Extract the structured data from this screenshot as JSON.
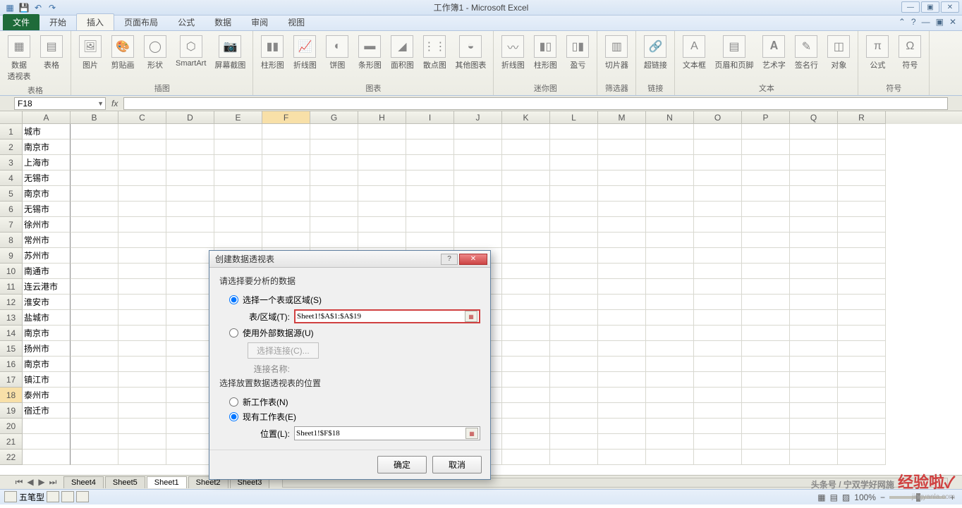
{
  "title": "工作簿1 - Microsoft Excel",
  "qat": {
    "save": "💾",
    "undo": "↶",
    "redo": "↷"
  },
  "wincontrols": {
    "min": "—",
    "max": "▣",
    "close": "✕"
  },
  "tabs": {
    "file": "文件",
    "home": "开始",
    "insert": "插入",
    "pagelayout": "页面布局",
    "formulas": "公式",
    "data": "数据",
    "review": "审阅",
    "view": "视图"
  },
  "ribbon": {
    "tables": {
      "label": "表格",
      "pivot": "数据\n透视表",
      "table": "表格"
    },
    "illus": {
      "label": "插图",
      "pic": "图片",
      "clip": "剪贴画",
      "shape": "形状",
      "smart": "SmartArt",
      "screenshot": "屏幕截图"
    },
    "charts": {
      "label": "图表",
      "column": "柱形图",
      "line": "折线图",
      "pie": "饼图",
      "bar": "条形图",
      "area": "面积图",
      "scatter": "散点图",
      "other": "其他图表"
    },
    "spark": {
      "label": "迷你图",
      "sline": "折线图",
      "scol": "柱形图",
      "swl": "盈亏"
    },
    "filter": {
      "label": "筛选器",
      "slicer": "切片器"
    },
    "links": {
      "label": "链接",
      "hyper": "超链接"
    },
    "text": {
      "label": "文本",
      "tbox": "文本框",
      "hf": "页眉和页脚",
      "wordart": "艺术字",
      "sig": "签名行",
      "obj": "对象"
    },
    "symbols": {
      "label": "符号",
      "eq": "公式",
      "sym": "符号"
    }
  },
  "namebox": "F18",
  "fx": "fx",
  "columns": [
    "A",
    "B",
    "C",
    "D",
    "E",
    "F",
    "G",
    "H",
    "I",
    "J",
    "K",
    "L",
    "M",
    "N",
    "O",
    "P",
    "Q",
    "R"
  ],
  "rows": [
    "1",
    "2",
    "3",
    "4",
    "5",
    "6",
    "7",
    "8",
    "9",
    "10",
    "11",
    "12",
    "13",
    "14",
    "15",
    "16",
    "17",
    "18",
    "19",
    "20",
    "21",
    "22"
  ],
  "data_a": [
    "城市",
    "南京市",
    "上海市",
    "无锡市",
    "南京市",
    "无锡市",
    "徐州市",
    "常州市",
    "苏州市",
    "南通市",
    "连云港市",
    "淮安市",
    "盐城市",
    "南京市",
    "扬州市",
    "南京市",
    "镇江市",
    "泰州市",
    "宿迁市",
    "",
    "",
    ""
  ],
  "sheets": {
    "s4": "Sheet4",
    "s5": "Sheet5",
    "s1": "Sheet1",
    "s2": "Sheet2",
    "s3": "Sheet3"
  },
  "dialog": {
    "title": "创建数据透视表",
    "section1": "请选择要分析的数据",
    "opt_range": "选择一个表或区域(S)",
    "lbl_range": "表/区域(T):",
    "val_range": "Sheet1!$A$1:$A$19",
    "opt_ext": "使用外部数据源(U)",
    "btn_conn": "选择连接(C)...",
    "lbl_conn": "连接名称:",
    "section2": "选择放置数据透视表的位置",
    "opt_new": "新工作表(N)",
    "opt_exist": "现有工作表(E)",
    "lbl_loc": "位置(L):",
    "val_loc": "Sheet1!$F$18",
    "ok": "确定",
    "cancel": "取消",
    "help": "?",
    "close": "✕"
  },
  "status": {
    "ime": "五笔型",
    "zoom": "100%"
  },
  "watermark": {
    "main": "头条号 / 宁双学好网施",
    "brand": "经验啦",
    "sub": "jingyanla.com"
  }
}
